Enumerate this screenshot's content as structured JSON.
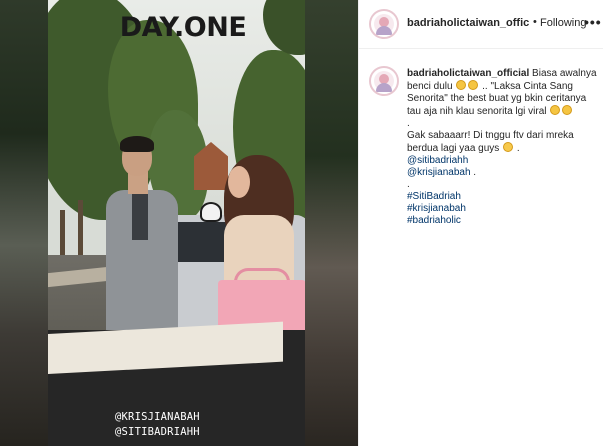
{
  "media": {
    "overlay_title": "DAY.ONE",
    "overlay_tags": [
      "@KRISJIANABAH",
      "@SITIBADRIAHH"
    ]
  },
  "post": {
    "username": "badriaholictaiwan_offic",
    "separator": "•",
    "follow_label": "Following",
    "more_icon": "more-horizontal-icon"
  },
  "caption": {
    "username": "badriaholictaiwan_official",
    "text_1": "Biasa awalnya benci dulu",
    "text_2": ".. \"Laksa Cinta Sang Senorita\" the best buat yg bkin ceritanya tau aja nih klau senorita lgi viral",
    "dot_1": ".",
    "text_3": "Gak sabaaarr! Di tnggu ftv dari mreka berdua lagi yaa guys",
    "text_3_end": ".",
    "mention_1": "@sitibadriahh",
    "mention_2": "@krisjianabah",
    "mention_2_end": ".",
    "dot_2": ".",
    "hashtags": [
      "#SitiBadriah",
      "#krisjianabah",
      "#badriaholic"
    ],
    "emoji_icon": "grinning-face-icon",
    "wink_icon": "winking-face-icon"
  }
}
